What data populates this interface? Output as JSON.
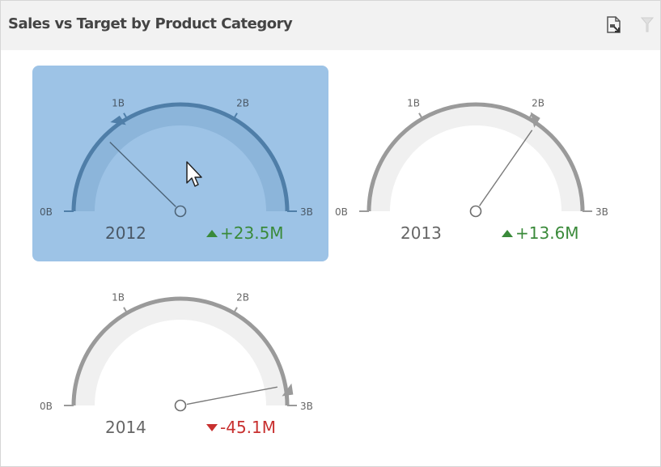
{
  "header": {
    "title": "Sales vs Target by Product Category",
    "export_icon": "export-to-image-icon",
    "clear_icon": "clear-master-filter-icon"
  },
  "scale_labels": [
    "0B",
    "1B",
    "2B",
    "3B"
  ],
  "gauges": [
    {
      "year": "2012",
      "delta": "+23.5M",
      "trend": "up",
      "value_b": 0.74,
      "target_b": 0.92,
      "selected": true
    },
    {
      "year": "2013",
      "delta": "+13.6M",
      "trend": "up",
      "value_b": 2.08,
      "target_b": 2.04,
      "selected": false
    },
    {
      "year": "2014",
      "delta": "-45.1M",
      "trend": "down",
      "value_b": 2.82,
      "target_b": 2.87,
      "selected": false
    }
  ],
  "colors": {
    "up": "#3a8a3a",
    "down": "#c8302f",
    "selected_bg": "#9dc3e6",
    "arc_normal": "#9a9a9a",
    "arc_selected": "#4f7ea8"
  }
}
